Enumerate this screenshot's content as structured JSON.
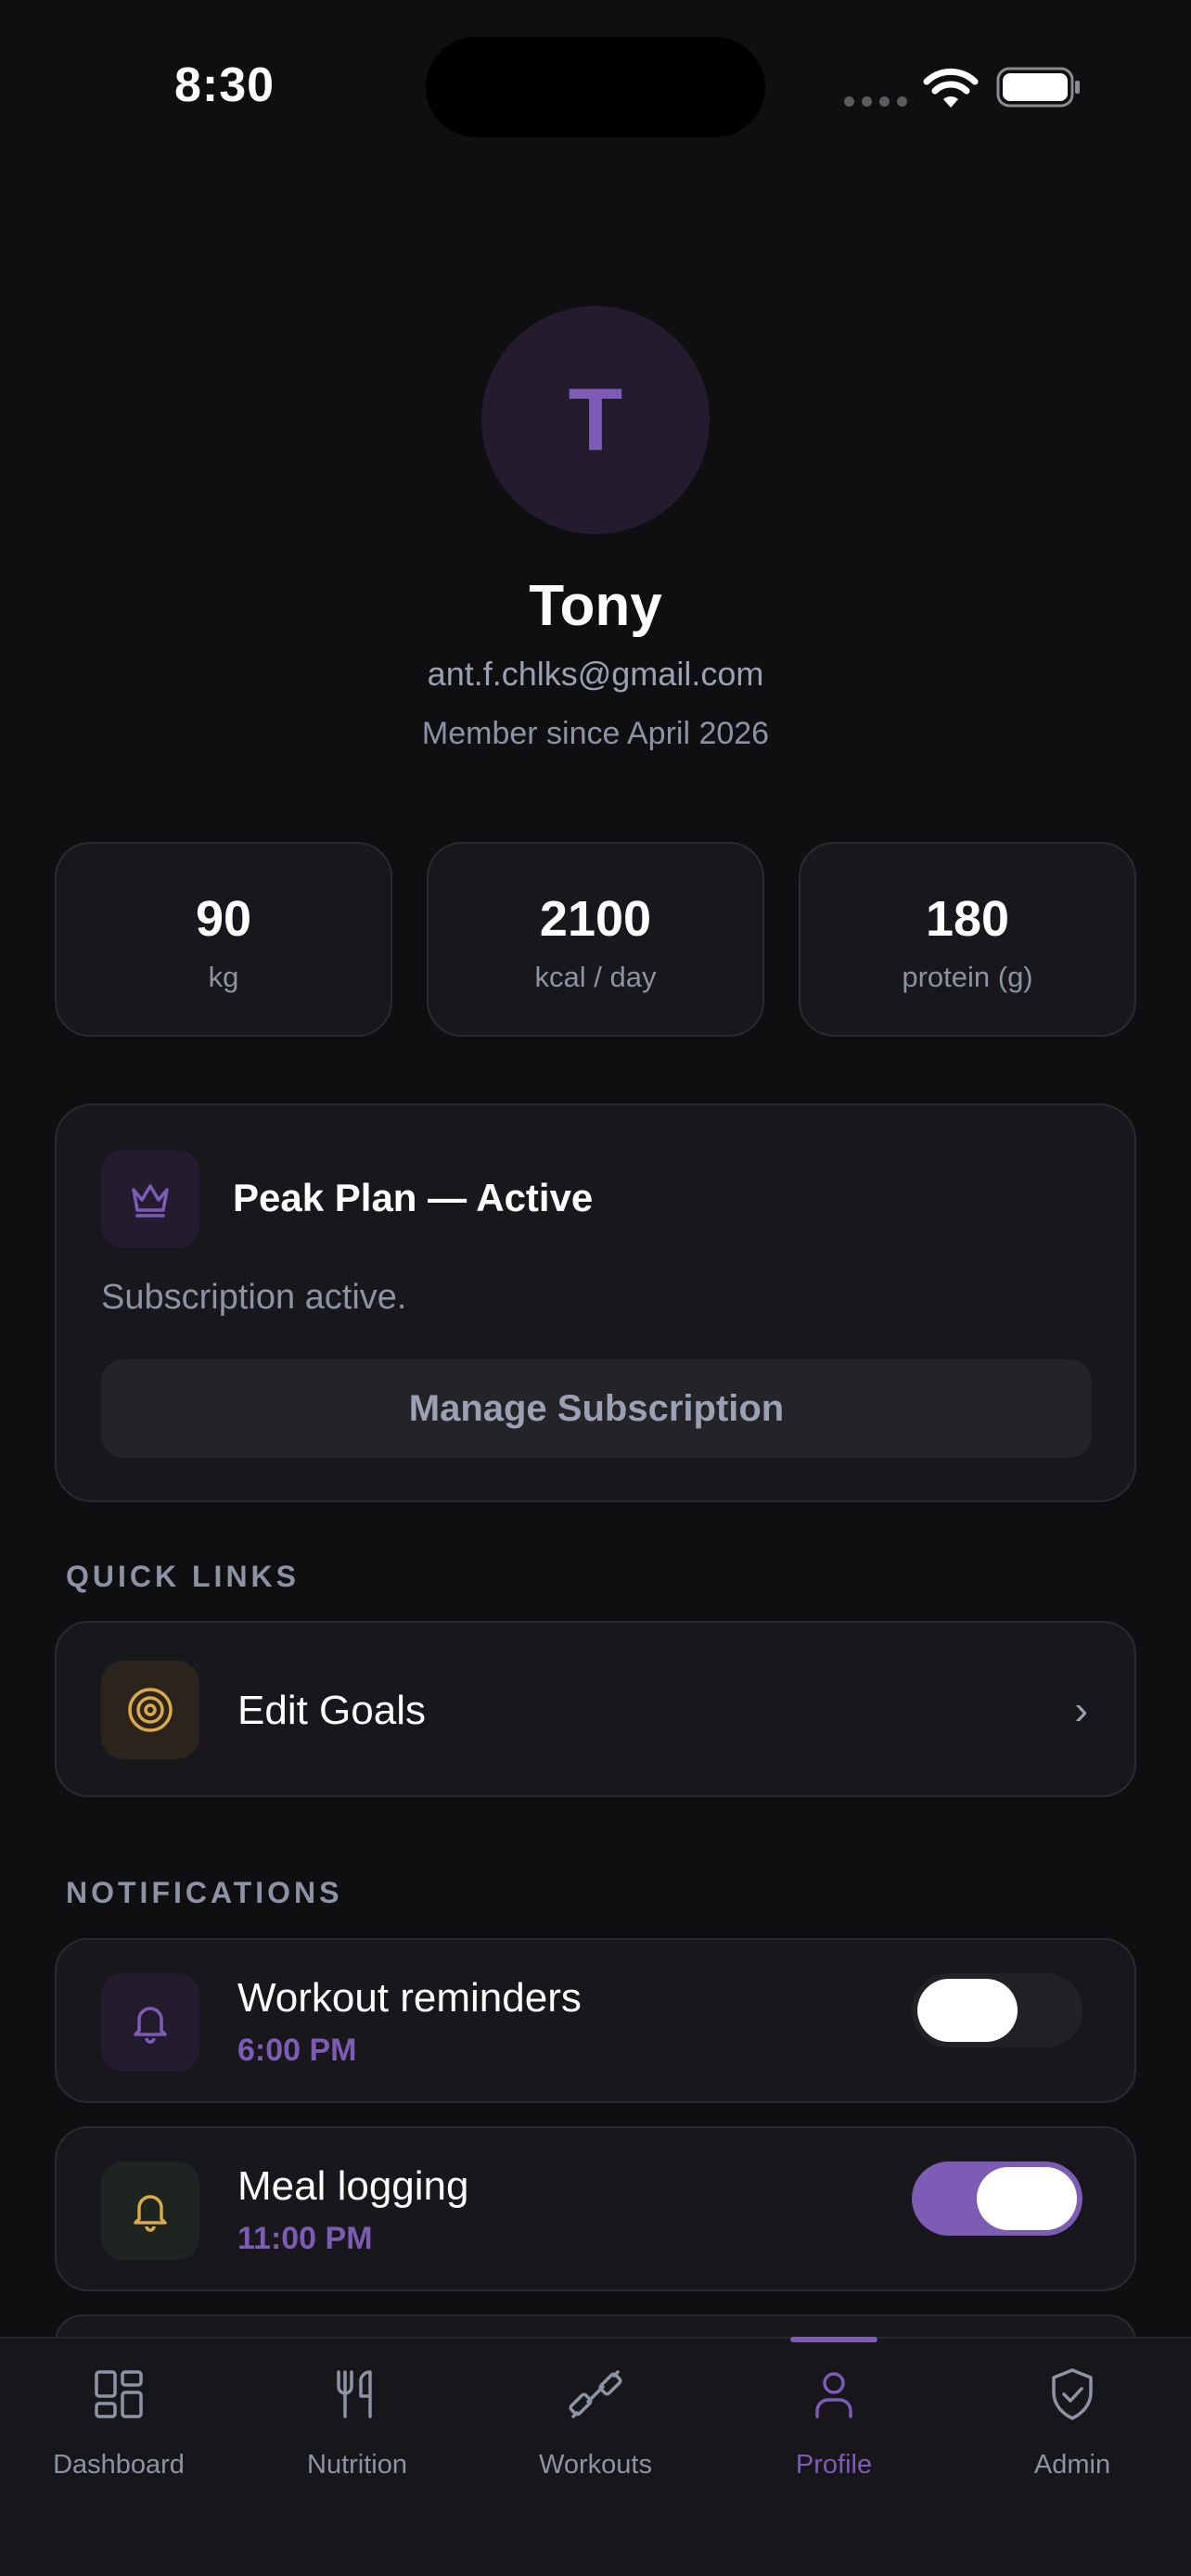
{
  "status_bar": {
    "time": "8:30"
  },
  "profile": {
    "avatar_initial": "T",
    "name": "Tony",
    "email": "ant.f.chlks@gmail.com",
    "member_since": "Member since April 2026"
  },
  "stats": [
    {
      "value": "90",
      "label": "kg"
    },
    {
      "value": "2100",
      "label": "kcal / day"
    },
    {
      "value": "180",
      "label": "protein (g)"
    }
  ],
  "plan": {
    "icon": "crown-icon",
    "title": "Peak Plan — Active",
    "subtitle": "Subscription active.",
    "button_label": "Manage Subscription"
  },
  "quick_links": {
    "label": "QUICK LINKS",
    "items": [
      {
        "icon": "target-icon",
        "label": "Edit Goals"
      }
    ]
  },
  "notifications": {
    "label": "NOTIFICATIONS",
    "items": [
      {
        "icon": "bell-icon",
        "title": "Workout reminders",
        "time": "6:00 PM",
        "enabled": false
      },
      {
        "icon": "bell-icon",
        "title": "Meal logging",
        "time": "11:00 PM",
        "enabled": true
      }
    ]
  },
  "nav": {
    "items": [
      {
        "label": "Dashboard",
        "icon": "dashboard-icon"
      },
      {
        "label": "Nutrition",
        "icon": "utensils-icon"
      },
      {
        "label": "Workouts",
        "icon": "dumbbell-icon"
      },
      {
        "label": "Profile",
        "icon": "user-icon",
        "active": true
      },
      {
        "label": "Admin",
        "icon": "shield-check-icon"
      }
    ]
  },
  "colors": {
    "accent": "#7d5cb5",
    "background": "#0f0f11",
    "card": "#18181c",
    "gold": "#d9a94a"
  }
}
